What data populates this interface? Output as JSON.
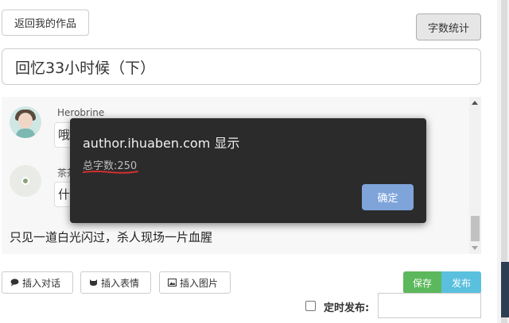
{
  "toolbar": {
    "back_label": "返回我的作品",
    "count_label": "字数统计"
  },
  "title_input": {
    "value": "回忆33小时候（下）"
  },
  "chat": {
    "messages": [
      {
        "speaker": "Herobrine",
        "text": "哦"
      },
      {
        "speaker": "茶茶",
        "text": "什"
      }
    ],
    "narration": "只见一道白光闪过，杀人现场一片血腥"
  },
  "tools": {
    "insert_dialog": "插入对话",
    "insert_emoji": "插入表情",
    "insert_image": "插入图片"
  },
  "actions": {
    "save": "保存",
    "publish": "发布"
  },
  "schedule": {
    "label": "定时发布:",
    "value": ""
  },
  "dialog": {
    "title": "author.ihuaben.com 显示",
    "message": "总字数:250",
    "ok": "确定"
  },
  "colors": {
    "save_green": "#5cb85c",
    "publish_blue": "#5bc0de",
    "dialog_bg": "#2b2b2b",
    "ok_blue": "#7ea4da",
    "underline_red": "#d0302f"
  }
}
